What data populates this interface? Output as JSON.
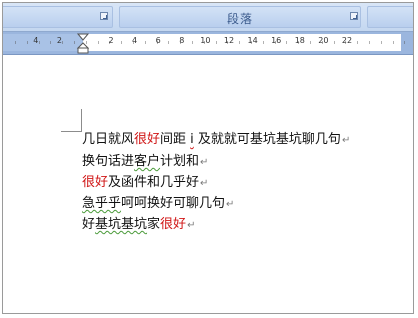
{
  "ribbon": {
    "paragraph_group_label": "段落"
  },
  "ruler": {
    "left_ticks": [
      "4",
      "2"
    ],
    "right_ticks": [
      "2",
      "4",
      "6",
      "8",
      "10",
      "12",
      "14",
      "16",
      "18",
      "20",
      "22"
    ]
  },
  "document": {
    "paragraph_mark": "↵",
    "lines": [
      {
        "segments": [
          {
            "text": "几日就风",
            "style": "normal"
          },
          {
            "text": "很好",
            "style": "red"
          },
          {
            "text": "间距 ",
            "style": "normal"
          },
          {
            "text": "i",
            "style": "squiggle"
          },
          {
            "text": " 及就就可基坑基坑聊几句",
            "style": "normal"
          }
        ]
      },
      {
        "segments": [
          {
            "text": "换句话进",
            "style": "normal"
          },
          {
            "text": "客户",
            "style": "squiggle-g"
          },
          {
            "text": "计划和",
            "style": "normal"
          }
        ]
      },
      {
        "segments": [
          {
            "text": "很好",
            "style": "red"
          },
          {
            "text": "及函件和几乎好",
            "style": "normal"
          }
        ]
      },
      {
        "segments": [
          {
            "text": "急乎乎",
            "style": "squiggle-g"
          },
          {
            "text": "呵呵换好可聊几句",
            "style": "normal"
          }
        ]
      },
      {
        "segments": [
          {
            "text": "好",
            "style": "normal"
          },
          {
            "text": "基坑基坑",
            "style": "squiggle-g"
          },
          {
            "text": "家",
            "style": "normal"
          },
          {
            "text": "很好",
            "style": "red"
          }
        ]
      }
    ]
  },
  "colors": {
    "ribbon": "#c4d7f0",
    "ruler_active": "#ffffff",
    "ruler_margin": "#9bb6de",
    "highlight_text": "#d01515"
  }
}
